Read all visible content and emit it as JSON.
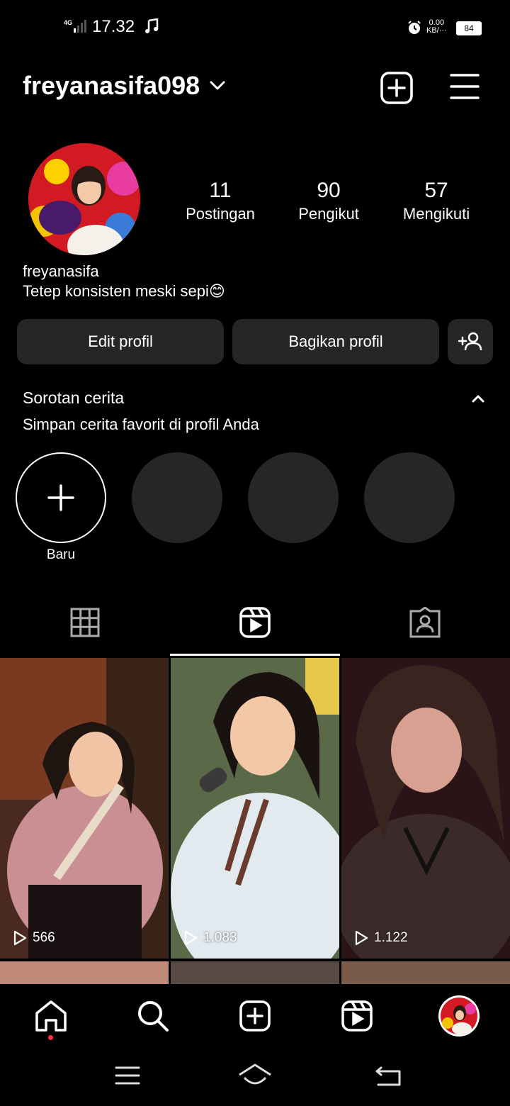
{
  "status_bar": {
    "network": "4G",
    "time": "17.32",
    "speed_top": "0.00",
    "speed_bottom": "KB/···",
    "battery": "84"
  },
  "header": {
    "username": "freyanasifa098"
  },
  "profile": {
    "stats": [
      {
        "value": "11",
        "label": "Postingan"
      },
      {
        "value": "90",
        "label": "Pengikut"
      },
      {
        "value": "57",
        "label": "Mengikuti"
      }
    ],
    "display_name": "freyanasifa",
    "bio": "Tetep konsisten meski sepi😊"
  },
  "buttons": {
    "edit": "Edit profil",
    "share": "Bagikan profil"
  },
  "highlights": {
    "title": "Sorotan cerita",
    "subtitle": "Simpan cerita favorit di profil Anda",
    "new_label": "Baru"
  },
  "reels": [
    {
      "views": "566"
    },
    {
      "views": "1.083"
    },
    {
      "views": "1.122"
    }
  ],
  "icons": [
    "chevron-down-icon",
    "new-post-icon",
    "menu-icon",
    "add-person-icon",
    "chevron-up-icon",
    "plus-icon",
    "grid-icon",
    "reels-icon",
    "tagged-icon",
    "play-icon",
    "home-icon",
    "search-icon",
    "create-icon",
    "reels-nav-icon",
    "profile-avatar",
    "recent-apps-icon",
    "home-system-icon",
    "back-icon"
  ],
  "colors": {
    "background": "#000000",
    "button_bg": "#262626",
    "notification_dot": "#ff3040"
  }
}
